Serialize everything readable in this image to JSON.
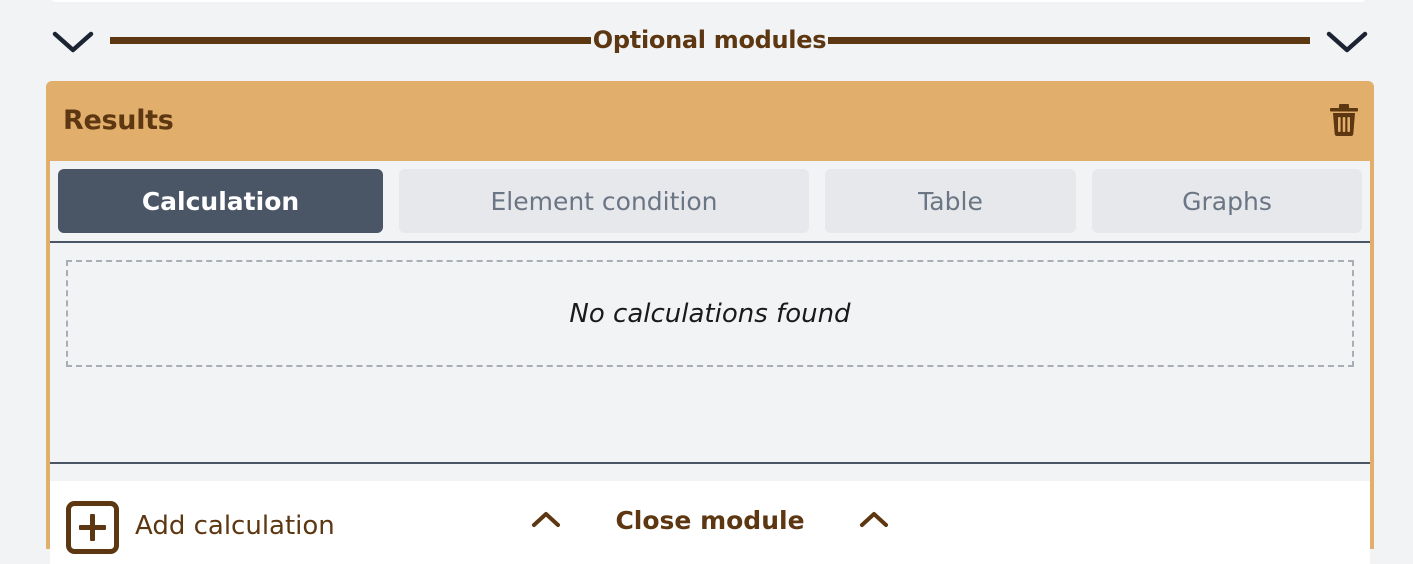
{
  "divider": {
    "title": "Optional modules",
    "left_icon": "chevron-down-icon",
    "right_icon": "chevron-down-icon"
  },
  "module": {
    "title": "Results",
    "delete_icon": "trash-icon",
    "tabs": [
      {
        "label": "Calculation",
        "active": true
      },
      {
        "label": "Element condition",
        "active": false
      },
      {
        "label": "Table",
        "active": false
      },
      {
        "label": "Graphs",
        "active": false
      }
    ],
    "empty_message": "No calculations found",
    "add_label": "Add calculation",
    "add_icon": "plus-square-icon",
    "footer": {
      "label": "Close module",
      "icon": "chevron-up-icon"
    }
  },
  "colors": {
    "accent_brown": "#5c3711",
    "module_orange": "#e2ae6b",
    "tab_active": "#4a5566",
    "tab_inactive": "#e6e8eb"
  }
}
